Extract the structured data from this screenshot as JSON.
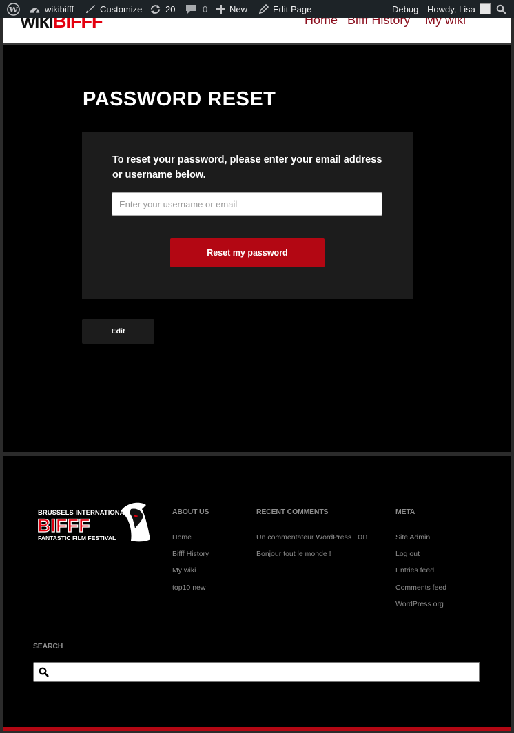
{
  "admin_bar": {
    "site_name": "wikibifff",
    "customize": "Customize",
    "updates_count": "20",
    "comments_count": "0",
    "new_label": "New",
    "edit_page": "Edit Page",
    "debug": "Debug",
    "howdy": "Howdy, Lisa"
  },
  "header": {
    "logo_wiki": "wiki",
    "logo_bifff": "BIFFF",
    "nav": [
      "Home",
      "Bifff History",
      "My wiki"
    ]
  },
  "main": {
    "title": "PASSWORD RESET",
    "instructions": "To reset your password, please enter your email address or username below.",
    "input_placeholder": "Enter your username or email",
    "reset_button": "Reset my password",
    "edit_button": "Edit"
  },
  "footer": {
    "badge_line1": "BRUSSELS INTERNATIONAL",
    "badge_line2": "BIFFF",
    "badge_line3": "FANTASTIC FILM FESTIVAL",
    "about_heading": "ABOUT US",
    "about_links": [
      "Home",
      "Bifff History",
      "My wiki",
      "top10 new"
    ],
    "recent_heading": "RECENT COMMENTS",
    "recent_author": "Un commentateur WordPress",
    "recent_on": "on",
    "recent_post": "Bonjour tout le monde !",
    "meta_heading": "META",
    "meta_links": [
      "Site Admin",
      "Log out",
      "Entries feed",
      "Comments feed",
      "WordPress.org"
    ],
    "search_heading": "SEARCH"
  },
  "colors": {
    "accent": "#b30713",
    "admin_bar": "#1d2327",
    "nav_text": "#8a0f1e"
  }
}
